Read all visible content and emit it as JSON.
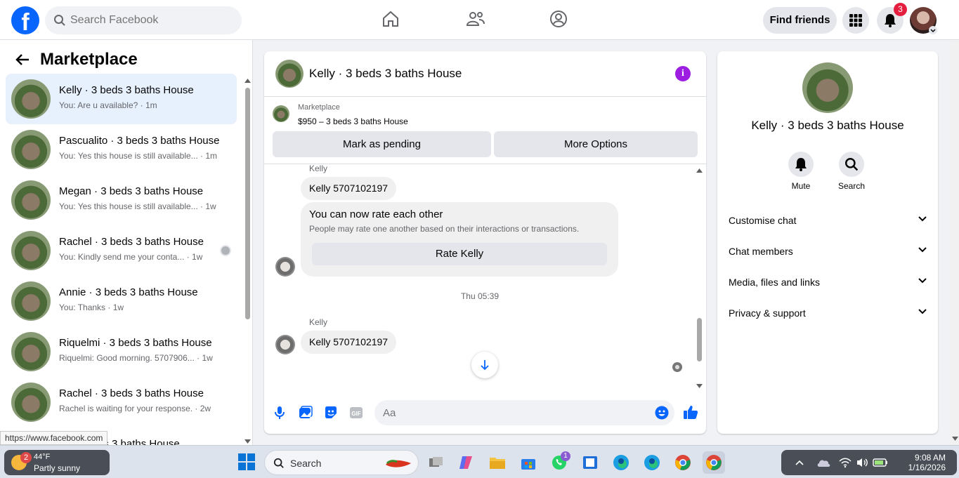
{
  "topbar": {
    "logo": "f",
    "search_placeholder": "Search Facebook",
    "find_friends": "Find friends",
    "notification_count": "3"
  },
  "left": {
    "title": "Marketplace",
    "conversations": [
      {
        "name": "Kelly · 3 beds 3 baths House",
        "preview": "You: Are u available? · 1m"
      },
      {
        "name": "Pascualito · 3 beds 3 baths House",
        "preview": "You: Yes this house is still available... · 1m"
      },
      {
        "name": "Megan · 3 beds 3 baths House",
        "preview": "You: Yes this house is still available... · 1w"
      },
      {
        "name": "Rachel · 3 beds 3 baths House",
        "preview": "You: Kindly send me your conta... · 1w"
      },
      {
        "name": "Annie · 3 beds 3 baths House",
        "preview": "You: Thanks · 1w"
      },
      {
        "name": "Riquelmi · 3 beds 3 baths House",
        "preview": "Riquelmi: Good morning. 5707906... · 1w"
      },
      {
        "name": "Rachel · 3 beds 3 baths House",
        "preview": "Rachel is waiting for your response. · 2w"
      },
      {
        "name": "... · 3 beds 3 baths House",
        "preview": ""
      }
    ],
    "status_url": "https://www.facebook.com"
  },
  "chat": {
    "title": "Kelly · 3 beds 3 baths House",
    "marketplace_label": "Marketplace",
    "listing": "$950 – 3 beds 3 baths House",
    "mark_pending": "Mark as pending",
    "more_options": "More Options",
    "sender": "Kelly",
    "msg1": "Kelly 5707102197",
    "rate_title": "You can now rate each other",
    "rate_sub": "People may rate one another based on their interactions or transactions.",
    "rate_button": "Rate Kelly",
    "timestamp": "Thu 05:39",
    "msg2": "Kelly 5707102197",
    "input_placeholder": "Aa"
  },
  "info": {
    "title": "Kelly · 3 beds 3 baths House",
    "mute": "Mute",
    "search": "Search",
    "rows": [
      "Customise chat",
      "Chat members",
      "Media, files and links",
      "Privacy & support"
    ]
  },
  "taskbar": {
    "weather_badge": "2",
    "temp": "44°F",
    "condition": "Partly sunny",
    "search_label": "Search",
    "whatsapp_badge": "1",
    "time": "9:08 AM",
    "date": "1/16/2026"
  }
}
